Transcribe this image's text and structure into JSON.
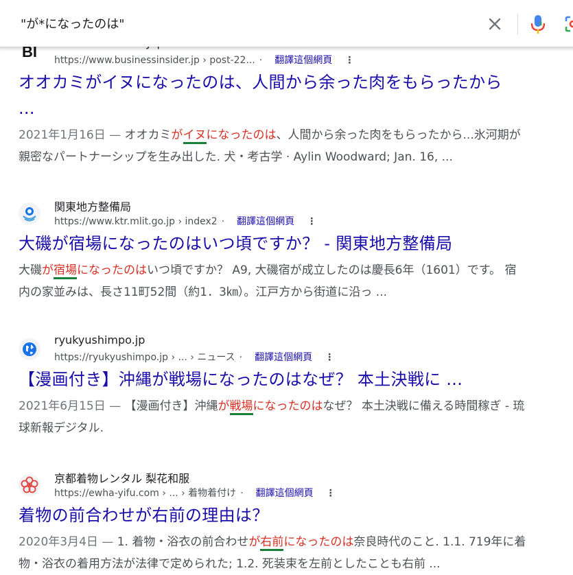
{
  "search": {
    "query": "\"が*になったのは\""
  },
  "results": [
    {
      "site_name": "Business Insider Japan",
      "favicon_text": "BI",
      "url": "https://www.businessinsider.jp › post-22...",
      "translate": "翻譯這個網頁",
      "title_line1": "オオカミがイヌになったのは、人間から余った肉をもらったから",
      "title_line2": "...",
      "date": "2021年1月16日 — ",
      "pre": "オオカミ",
      "hl1": "が",
      "hl2": "イヌ",
      "hl3": "になったのは",
      "post": "、人間から余った肉をもらったから...氷河期が",
      "line2": "親密なパートナーシップを生み出した. 犬・考古学 · Aylin Woodward; Jan. 16, ..."
    },
    {
      "site_name": "関東地方整備局",
      "url": "https://www.ktr.mlit.go.jp › index2",
      "translate": "翻譯這個網頁",
      "title": "大磯が宿場になったのはいつ頃ですか？ - 関東地方整備局",
      "pre": "大磯",
      "hl1": "が",
      "hl2": "宿場",
      "hl3": "になったのは",
      "post": "いつ頃ですか？ A9, 大磯宿が成立したのは慶長6年（1601）です。 宿",
      "line2": "内の家並みは、長さ11町52間（約1．3㎞）。江戸方から街道に沿っ ..."
    },
    {
      "site_name": "ryukyushimpo.jp",
      "url": "https://ryukyushimpo.jp › ... › ニュース",
      "translate": "翻譯這個網頁",
      "title": "【漫画付き】沖縄が戦場になったのはなぜ？ 本土決戦に ...",
      "date": "2021年6月15日 — ",
      "pre": "【漫画付き】沖縄",
      "hl1": "が",
      "hl2": "戦場",
      "hl3": "になったのは",
      "post": "なぜ？ 本土決戦に備える時間稼ぎ - 琉",
      "line2": "球新報デジタル."
    },
    {
      "site_name": "京都着物レンタル 梨花和服",
      "url": "https://ewha-yifu.com › ... › 着物着付け",
      "translate": "翻譯這個網頁",
      "title": "着物の前合わせが右前の理由は？",
      "date": "2020年3月4日 — ",
      "pre": "1. 着物・浴衣の前合わせ",
      "hl1": "が",
      "hl2": "右前",
      "hl3": "になったのは",
      "post": "奈良時代のこと. 1.1. 719年に着",
      "line2": "物・浴衣の着用方法が法律で定められた; 1.2. 死装束を左前としたことも右前 ..."
    }
  ],
  "colors": {
    "link": "#1a0dab",
    "highlight": "#d93025",
    "underline": "#188038"
  }
}
